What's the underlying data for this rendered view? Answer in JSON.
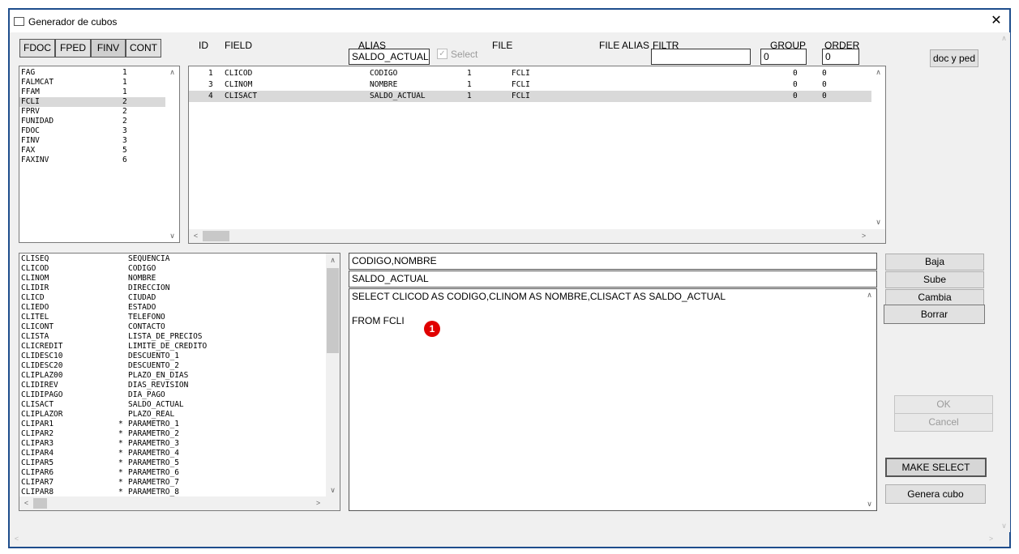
{
  "window": {
    "title": "Generador de cubos",
    "close": "✕"
  },
  "file_tabs": [
    "FDOC",
    "FPED",
    "FINV",
    "CONT"
  ],
  "headers": {
    "id": "ID",
    "field": "FIELD",
    "alias": "ALIAS",
    "select": "Select",
    "file": "FILE",
    "file_alias": "FILE ALIAS",
    "filtr": "FILTR",
    "group": "GROUP",
    "order": "ORDER"
  },
  "inputs": {
    "alias_value": "SALDO_ACTUAL",
    "filtr_value": "",
    "group_value": "0",
    "order_value": "0"
  },
  "doc_y_ped": "doc y ped",
  "files_list": [
    {
      "name": "FAG",
      "n": "1"
    },
    {
      "name": "FALMCAT",
      "n": "1"
    },
    {
      "name": "FFAM",
      "n": "1"
    },
    {
      "name": "FCLI",
      "n": "2",
      "selected": true
    },
    {
      "name": "FPRV",
      "n": "2"
    },
    {
      "name": "FUNIDAD",
      "n": "2"
    },
    {
      "name": "FDOC",
      "n": "3"
    },
    {
      "name": "FINV",
      "n": "3"
    },
    {
      "name": "FAX",
      "n": "5"
    },
    {
      "name": "FAXINV",
      "n": "6"
    }
  ],
  "selected_fields": [
    {
      "id": "1",
      "field": "CLICOD",
      "alias": "CODIGO",
      "sel": "1",
      "file": "FCLI",
      "group": "0",
      "order": "0"
    },
    {
      "id": "3",
      "field": "CLINOM",
      "alias": "NOMBRE",
      "sel": "1",
      "file": "FCLI",
      "group": "0",
      "order": "0"
    },
    {
      "id": "4",
      "field": "CLISACT",
      "alias": "SALDO_ACTUAL",
      "sel": "1",
      "file": "FCLI",
      "group": "0",
      "order": "0",
      "selected": true
    }
  ],
  "field_list": [
    {
      "field": "CLISEQ",
      "star": "",
      "alias": "SEQUENCIA"
    },
    {
      "field": "CLICOD",
      "star": "",
      "alias": "CODIGO"
    },
    {
      "field": "CLINOM",
      "star": "",
      "alias": "NOMBRE"
    },
    {
      "field": "CLIDIR",
      "star": "",
      "alias": "DIRECCION"
    },
    {
      "field": "CLICD",
      "star": "",
      "alias": "CIUDAD"
    },
    {
      "field": "CLIEDO",
      "star": "",
      "alias": "ESTADO"
    },
    {
      "field": "CLITEL",
      "star": "",
      "alias": "TELEFONO"
    },
    {
      "field": "CLICONT",
      "star": "",
      "alias": "CONTACTO"
    },
    {
      "field": "CLISTA",
      "star": "",
      "alias": "LISTA_DE_PRECIOS"
    },
    {
      "field": "CLICREDIT",
      "star": "",
      "alias": "LIMITE_DE_CREDITO"
    },
    {
      "field": "CLIDESC10",
      "star": "",
      "alias": "DESCUENTO_1"
    },
    {
      "field": "CLIDESC20",
      "star": "",
      "alias": "DESCUENTO_2"
    },
    {
      "field": "CLIPLAZ00",
      "star": "",
      "alias": "PLAZO_EN_DIAS"
    },
    {
      "field": "CLIDIREV",
      "star": "",
      "alias": "DIAS_REVISION"
    },
    {
      "field": "CLIDIPAGO",
      "star": "",
      "alias": "DIA_PAGO"
    },
    {
      "field": "CLISACT",
      "star": "",
      "alias": "SALDO_ACTUAL"
    },
    {
      "field": "CLIPLAZOR",
      "star": "",
      "alias": "PLAZO_REAL"
    },
    {
      "field": "CLIPAR1",
      "star": "*",
      "alias": "PARAMETRO_1"
    },
    {
      "field": "CLIPAR2",
      "star": "*",
      "alias": "PARAMETRO_2"
    },
    {
      "field": "CLIPAR3",
      "star": "*",
      "alias": "PARAMETRO_3"
    },
    {
      "field": "CLIPAR4",
      "star": "*",
      "alias": "PARAMETRO_4"
    },
    {
      "field": "CLIPAR5",
      "star": "*",
      "alias": "PARAMETRO_5"
    },
    {
      "field": "CLIPAR6",
      "star": "*",
      "alias": "PARAMETRO_6"
    },
    {
      "field": "CLIPAR7",
      "star": "*",
      "alias": "PARAMETRO_7"
    },
    {
      "field": "CLIPAR8",
      "star": "*",
      "alias": "PARAMETRO_8"
    }
  ],
  "query": {
    "aliases_line": "CODIGO,NOMBRE",
    "current_alias": "SALDO_ACTUAL",
    "sql_line1": "SELECT CLICOD AS CODIGO,CLINOM AS NOMBRE,CLISACT AS SALDO_ACTUAL",
    "sql_line2": "FROM FCLI"
  },
  "marker": "1",
  "actions": {
    "baja": "Baja",
    "sube": "Sube",
    "cambia": "Cambia",
    "borrar": "Borrar",
    "ok": "OK",
    "cancel": "Cancel",
    "make_select": "MAKE SELECT",
    "genera_cubo": "Genera cubo"
  },
  "colors": {
    "window_border": "#1e4d8c",
    "marker": "#e00000"
  }
}
